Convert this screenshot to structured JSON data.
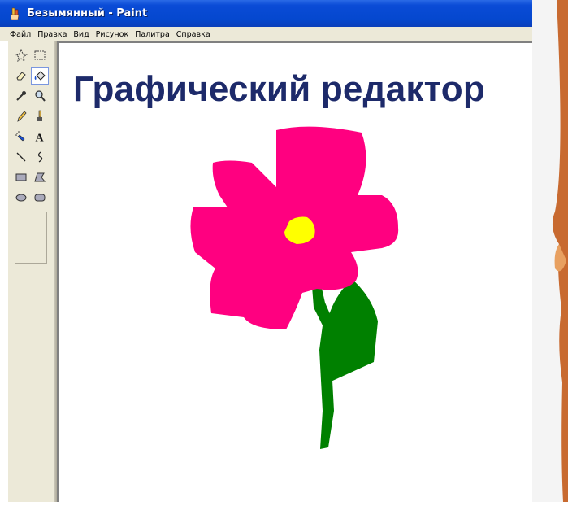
{
  "window": {
    "title": "Безымянный - Paint"
  },
  "menu": {
    "items": [
      "Файл",
      "Правка",
      "Вид",
      "Рисунок",
      "Палитра",
      "Справка"
    ]
  },
  "slide": {
    "heading": "Графический редактор"
  },
  "colors": {
    "petals": "#ff0080",
    "center": "#ffff00",
    "stem": "#008000",
    "heading": "#1d2a6a",
    "titlebar": "#0a4bd6",
    "toolbox": "#ece9d8"
  },
  "toolbox": {
    "tools": [
      "free-form-select-icon",
      "rect-select-icon",
      "eraser-icon",
      "fill-bucket-icon",
      "color-picker-icon",
      "magnifier-icon",
      "pencil-icon",
      "brush-icon",
      "airbrush-icon",
      "text-icon",
      "line-icon",
      "curve-icon",
      "rectangle-icon",
      "polygon-icon",
      "ellipse-icon",
      "rounded-rectangle-icon"
    ],
    "selected": "fill-bucket-icon"
  }
}
